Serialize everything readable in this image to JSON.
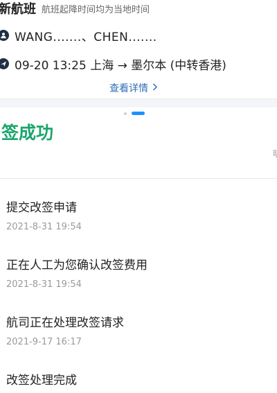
{
  "flight_card": {
    "title": "新航班",
    "note": "航班起降时间均为当地时间",
    "passenger_icon": "person-icon",
    "passengers": "WANG.......、CHEN.......",
    "flight_icon": "plane-icon",
    "flight_info": "09-20 13:25 上海 → 墨尔本 (中转香港)",
    "detail_link": "查看详情",
    "detail_chevron": "chevron-right-icon"
  },
  "pager": {
    "count": 2,
    "active_index": 1
  },
  "status": {
    "title": "签成功",
    "side_text": "明"
  },
  "steps": [
    {
      "title": "提交改签申请",
      "time": "2021-8-31 19:54"
    },
    {
      "title": "正在人工为您确认改签费用",
      "time": "2021-8-31 19:54"
    },
    {
      "title": "航司正在处理改签请求",
      "time": "2021-9-17 16:17"
    },
    {
      "title": "改签处理完成",
      "time": ""
    }
  ],
  "colors": {
    "success_green": "#1aa56d",
    "link_blue": "#2f6fb7",
    "pager_active": "#1e90ff"
  }
}
